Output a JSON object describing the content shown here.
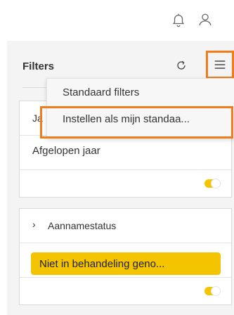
{
  "topbar": {
    "notifications_icon": "bell-icon",
    "user_icon": "user-icon"
  },
  "filters": {
    "title": "Filters",
    "reset_icon": "refresh-icon",
    "menu_icon": "hamburger-menu-icon"
  },
  "dropdown": {
    "items": [
      {
        "label": "Standaard filters"
      },
      {
        "label": "Instellen als mijn standaa..."
      }
    ]
  },
  "cards": [
    {
      "title": "Ja",
      "value": "Afgelopen jaar",
      "toggle_on": true
    },
    {
      "title": "Aannamestatus",
      "chevron": "›",
      "chip": "Niet in behandeling geno...",
      "toggle_on": true
    }
  ],
  "colors": {
    "accent_orange": "#f07c1b",
    "chip_yellow": "#f5c400",
    "panel_bg": "#f4f4f4"
  }
}
